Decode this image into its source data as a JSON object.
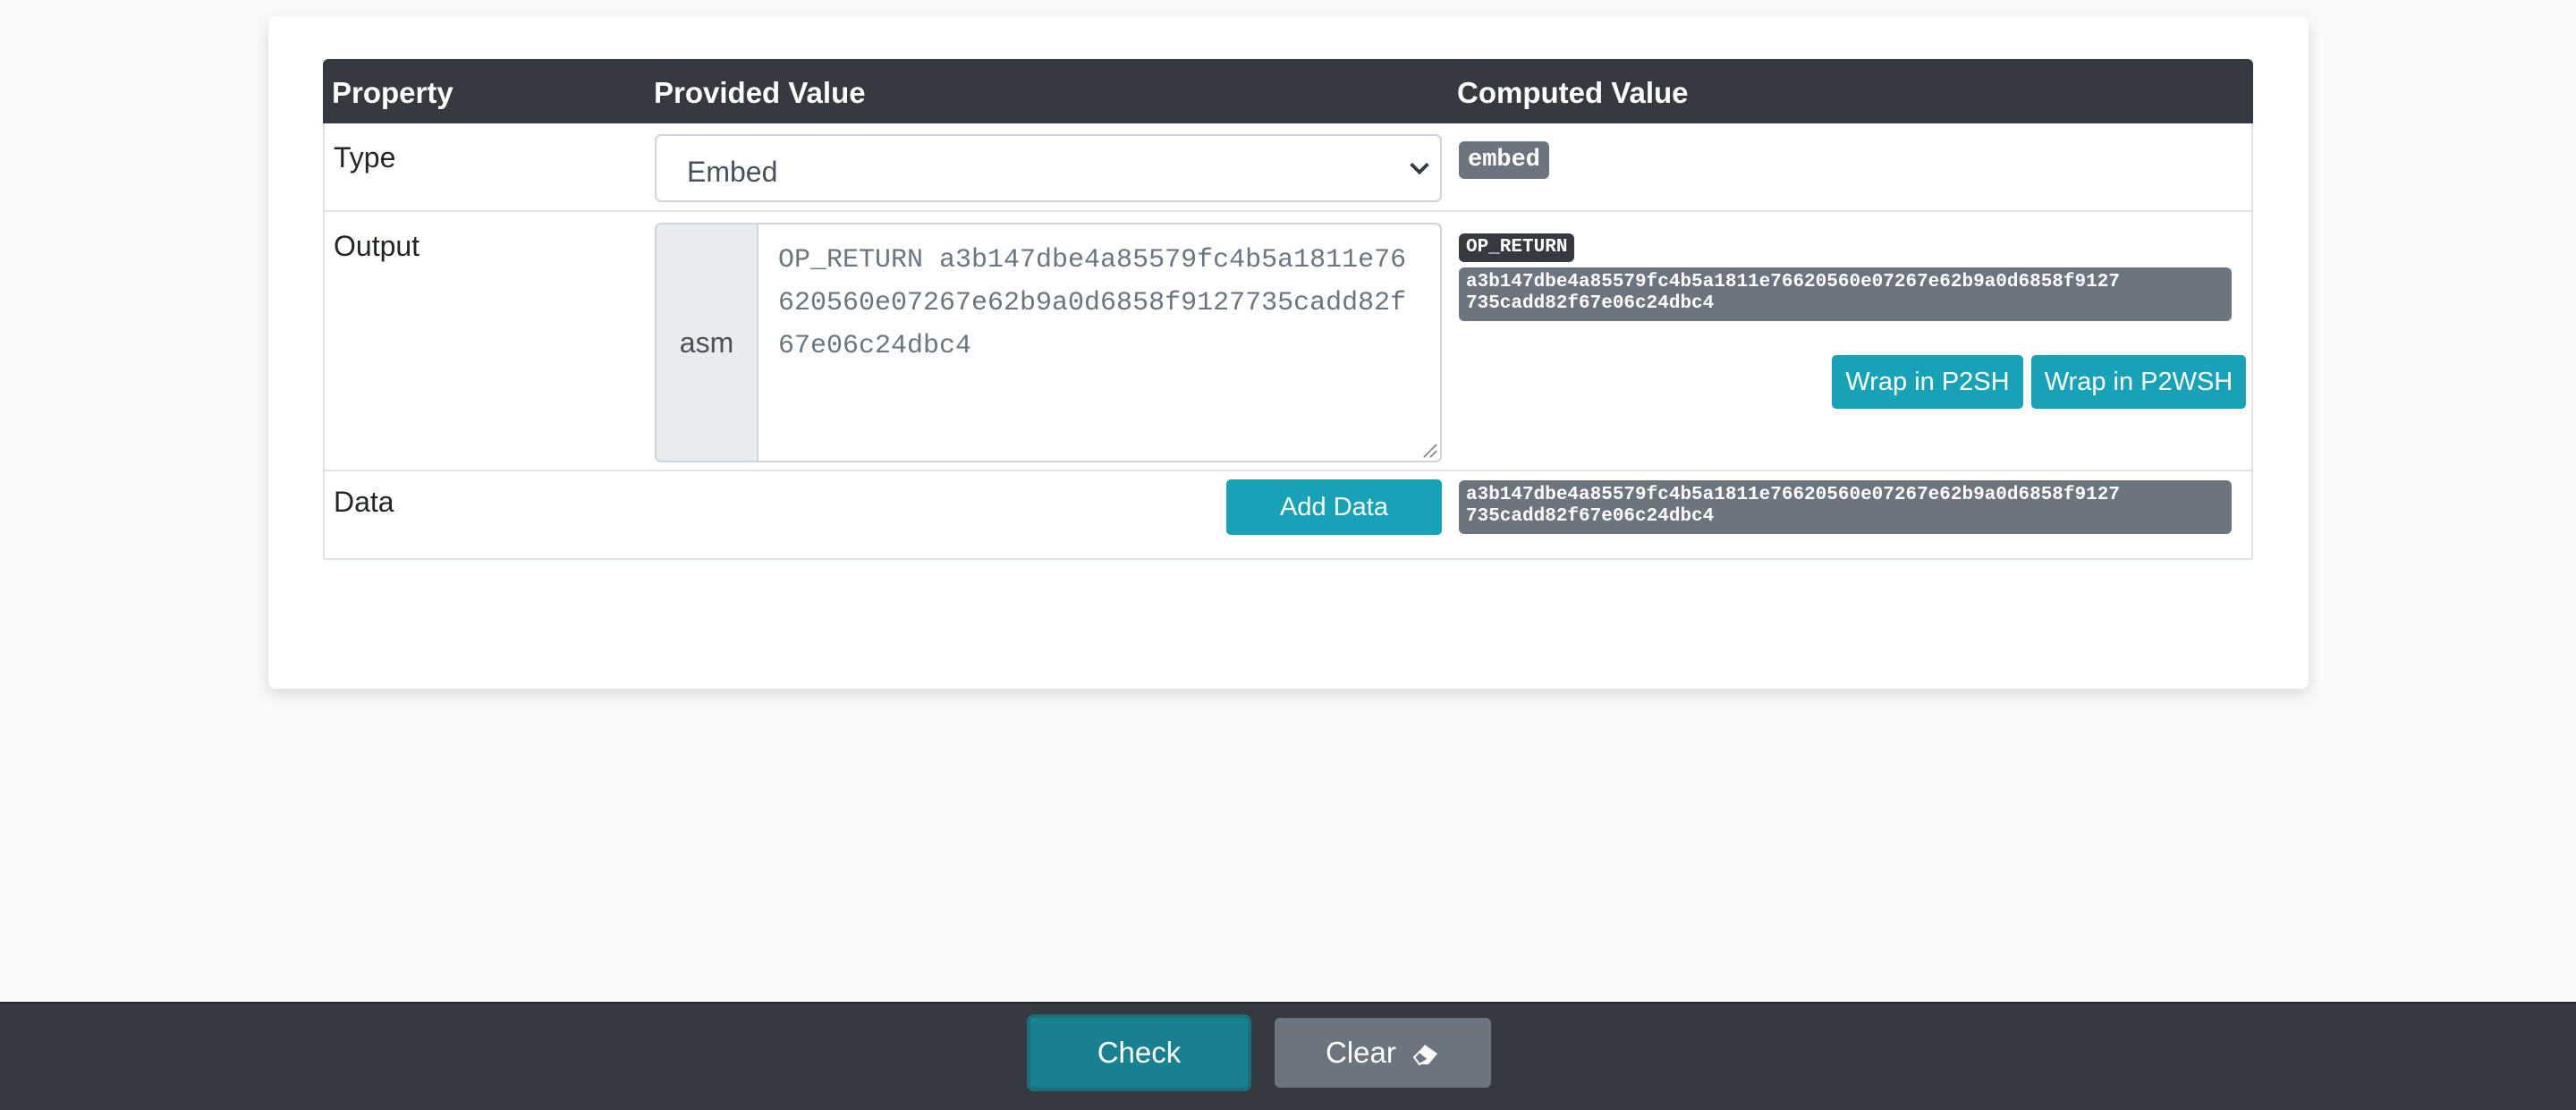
{
  "table": {
    "headers": [
      "Property",
      "Provided Value",
      "Computed Value"
    ]
  },
  "type_row": {
    "label": "Type",
    "selected": "Embed",
    "computed_badge": "embed"
  },
  "output_row": {
    "label": "Output",
    "prefix": "asm",
    "asm_value": "OP_RETURN a3b147dbe4a85579fc4b5a1811e76620560e07267e62b9a0d6858f9127735cadd82f67e06c24dbc4",
    "op_badge": "OP_RETURN",
    "hex_line1": "a3b147dbe4a85579fc4b5a1811e76620560e07267e62b9a0d6858f9127",
    "hex_line2": "735cadd82f67e06c24dbc4",
    "wrap_p2sh": "Wrap in P2SH",
    "wrap_p2wsh": "Wrap in P2WSH"
  },
  "data_row": {
    "label": "Data",
    "add_button": "Add Data",
    "hex_line1": "a3b147dbe4a85579fc4b5a1811e76620560e07267e62b9a0d6858f9127",
    "hex_line2": "735cadd82f67e06c24dbc4"
  },
  "footer": {
    "check_label": "Check",
    "clear_label": "Clear"
  },
  "colors": {
    "header_bg": "#343a40",
    "info": "#17a2b8",
    "secondary": "#6c757d"
  }
}
